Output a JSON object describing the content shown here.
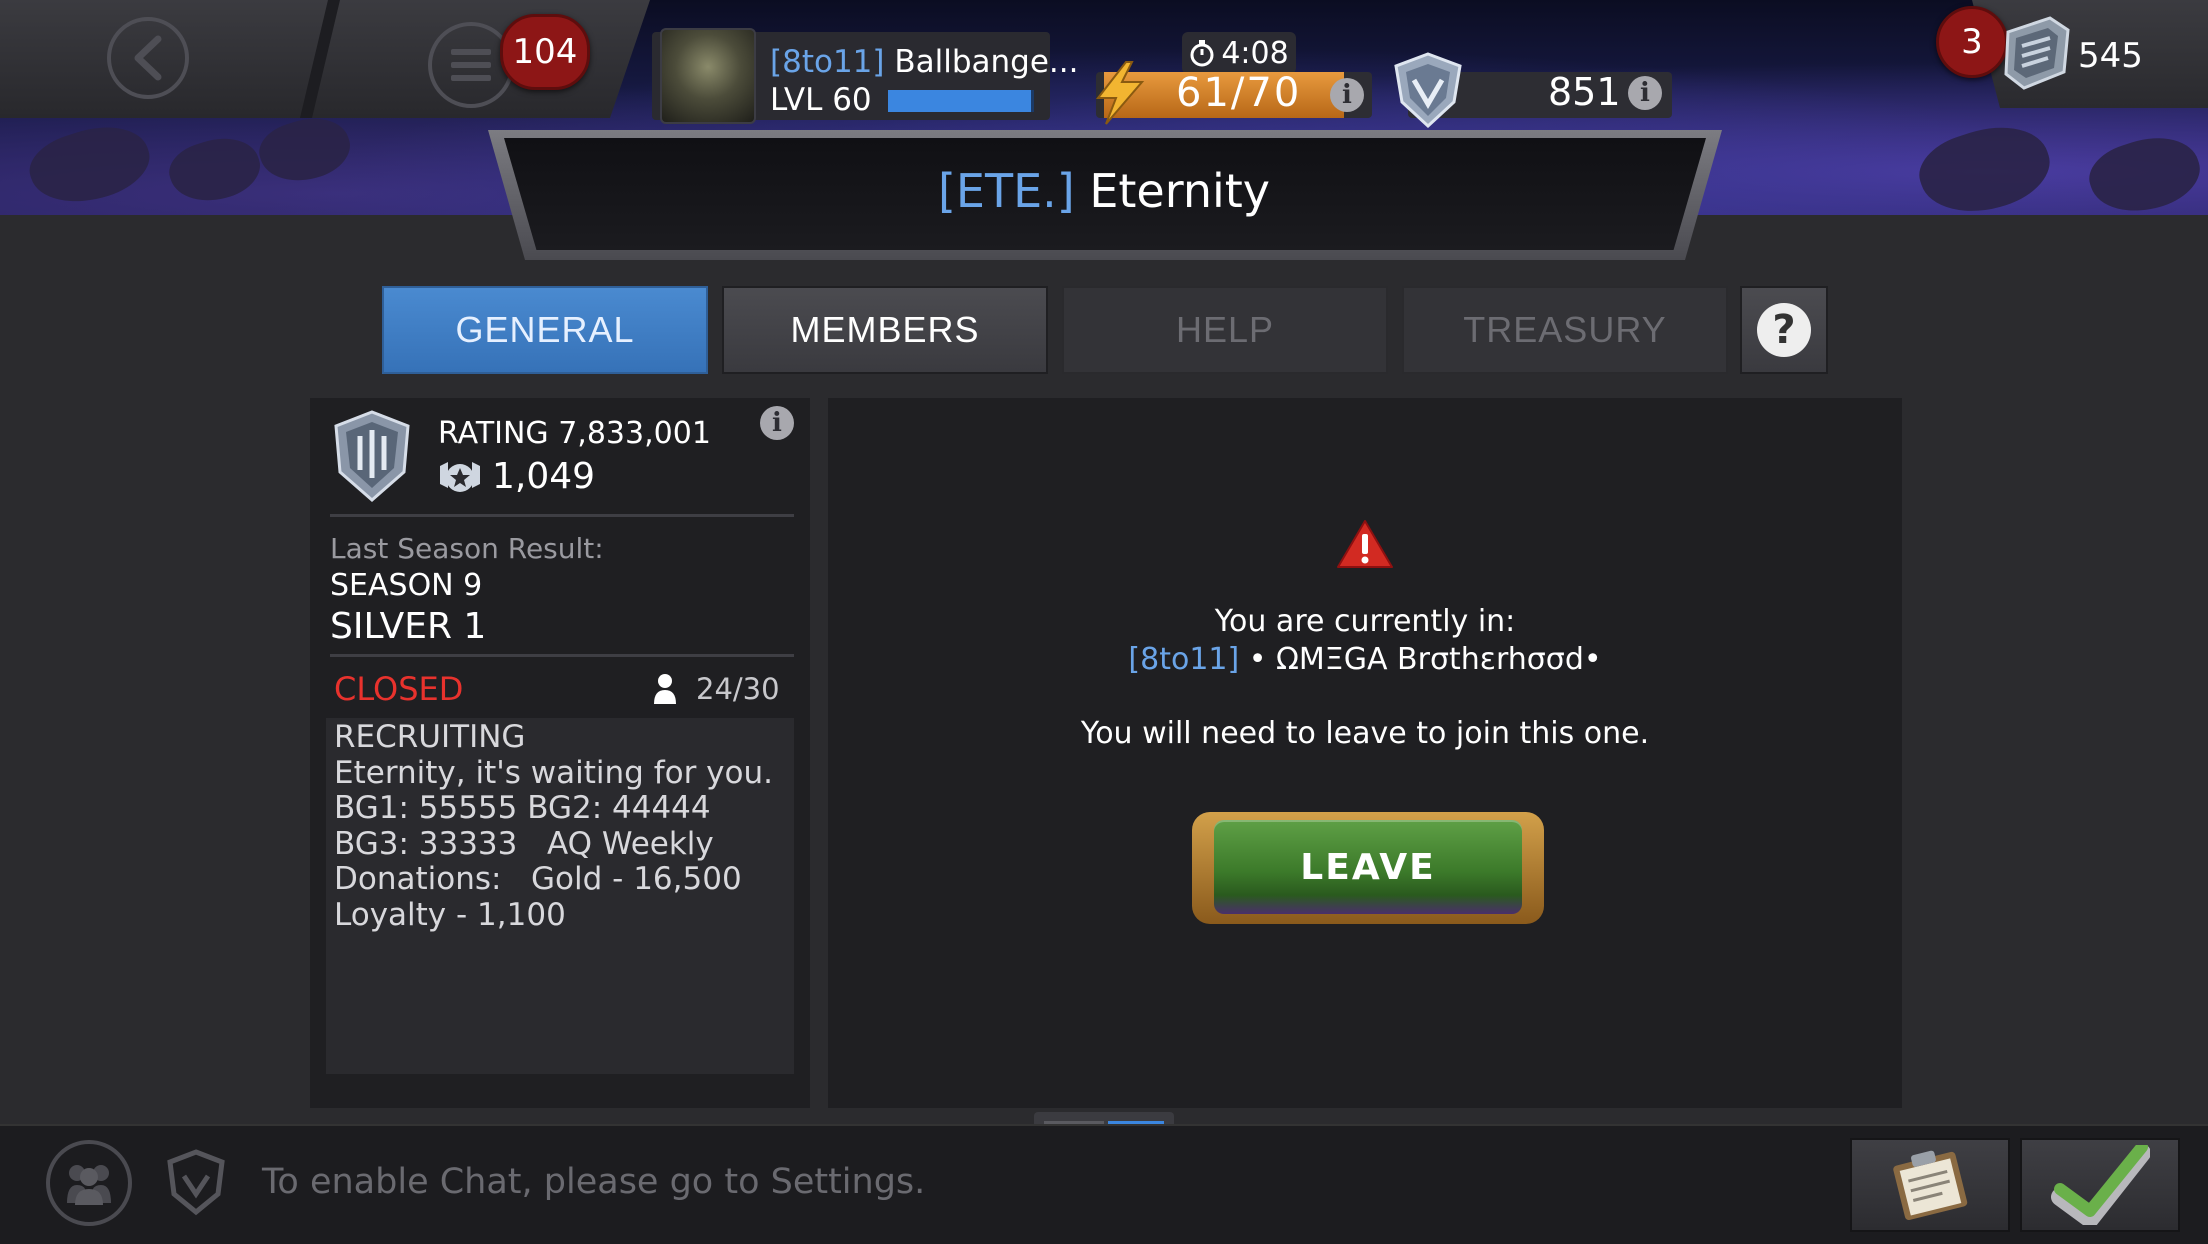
{
  "top_bar": {
    "notifications_count": "104",
    "player": {
      "alliance_tag": "[8to11]",
      "name": "Ballbange...",
      "level": "LVL 60",
      "xp_fraction": 0.98
    },
    "energy": {
      "timer": "4:08",
      "value": "61/70",
      "fill_fraction": 0.87
    },
    "shield_points": "851",
    "units_badge": "3",
    "units": "545"
  },
  "alliance": {
    "tag": "[ETE.]",
    "name": "Eternity"
  },
  "tabs": [
    {
      "label": "GENERAL",
      "state": "active"
    },
    {
      "label": "MEMBERS",
      "state": "normal"
    },
    {
      "label": "HELP",
      "state": "disabled"
    },
    {
      "label": "TREASURY",
      "state": "disabled"
    }
  ],
  "info_panel": {
    "rating": "RATING 7,833,001",
    "score": "1,049",
    "last_season_label": "Last Season Result:",
    "season": "SEASON 9",
    "tier": "SILVER 1",
    "status": "CLOSED",
    "members": "24/30",
    "description": "RECRUITING\nEternity, it's waiting for you.\nBG1: 55555 BG2: 44444\nBG3: 33333   AQ Weekly\nDonations:   Gold - 16,500\nLoyalty - 1,100"
  },
  "notice": {
    "line1": "You are currently in:",
    "current_alliance_tag": "[8to11]",
    "current_alliance_name": " • ΩMΞGA Brσthεrhσσd•",
    "line3": "You will need to leave to join this one.",
    "leave_label": "LEAVE"
  },
  "chat": {
    "placeholder": "To enable Chat, please go to Settings."
  },
  "colors": {
    "accent_blue": "#3b86e0",
    "tag_blue": "#6aa4e8",
    "closed_red": "#e8322d",
    "leave_green": "#3c7a2a",
    "energy_orange": "#e89a3e"
  }
}
